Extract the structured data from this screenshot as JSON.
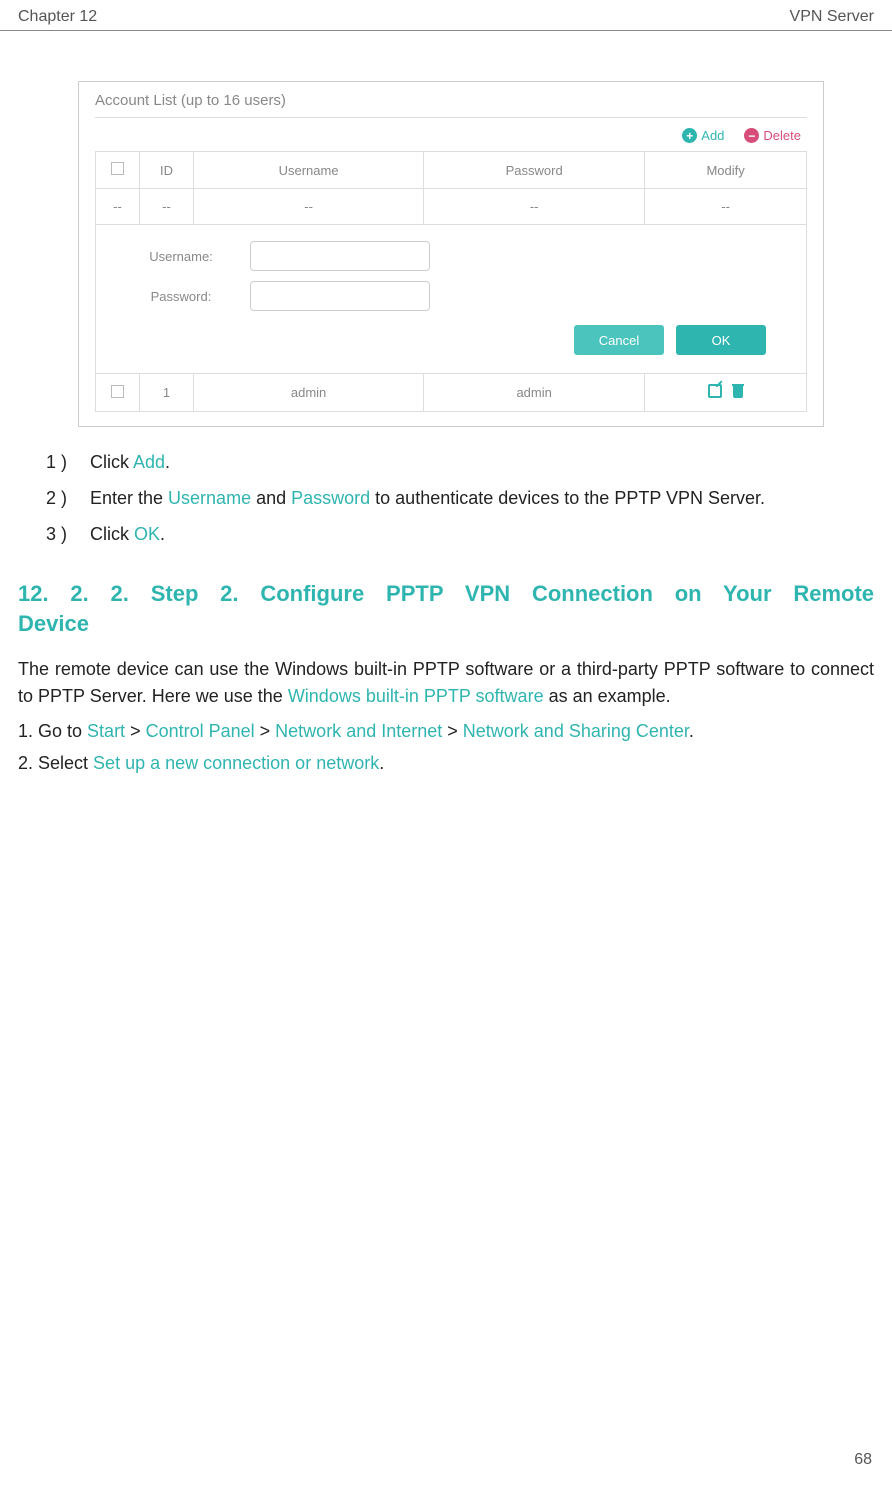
{
  "header": {
    "chapter": "Chapter 12",
    "topic": "VPN Server"
  },
  "panel": {
    "title": "Account List (up to 16 users)",
    "add_label": "Add",
    "delete_label": "Delete",
    "columns": {
      "id": "ID",
      "username": "Username",
      "password": "Password",
      "modify": "Modify"
    },
    "placeholder_row": {
      "id": "--",
      "username": "--",
      "password": "--",
      "modify": "--"
    },
    "form": {
      "username_label": "Username:",
      "password_label": "Password:",
      "cancel": "Cancel",
      "ok": "OK"
    },
    "row": {
      "id": "1",
      "username": "admin",
      "password": "admin"
    }
  },
  "steps_small": {
    "s1_mark": "1 )",
    "s1_a": "Click ",
    "s1_b": "Add",
    "s1_c": ".",
    "s2_mark": "2 )",
    "s2_a": "Enter the ",
    "s2_b": "Username",
    "s2_c": " and ",
    "s2_d": "Password",
    "s2_e": " to authenticate devices to the PPTP VPN Server.",
    "s3_mark": "3 )",
    "s3_a": "Click ",
    "s3_b": "OK",
    "s3_c": "."
  },
  "section": {
    "heading_l1": "12. 2. 2.   Step 2. Configure PPTP VPN Connection on Your Remote",
    "heading_l2": "Device",
    "para_a": "The remote device can use the Windows built-in PPTP software or a third-party PPTP software to connect to PPTP Server. Here we use the ",
    "para_b": "Windows built-in PPTP software",
    "para_c": " as an example.",
    "step1_a": "1. Go to ",
    "step1_b": "Start",
    "step1_c": " > ",
    "step1_d": "Control Panel",
    "step1_e": " > ",
    "step1_f": "Network and Internet",
    "step1_g": " > ",
    "step1_h": "Network and Sharing Center",
    "step1_i": ".",
    "step2_a": "2. Select ",
    "step2_b": "Set up a new connection or network",
    "step2_c": "."
  },
  "page_number": "68"
}
